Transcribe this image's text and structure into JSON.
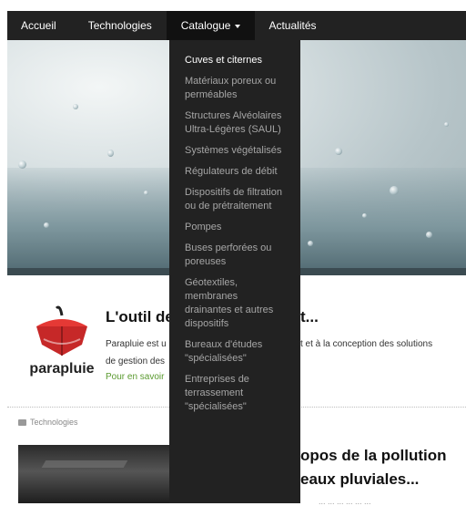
{
  "nav": {
    "items": [
      {
        "label": "Accueil"
      },
      {
        "label": "Technologies"
      },
      {
        "label": "Catalogue"
      },
      {
        "label": "Actualités"
      }
    ]
  },
  "dropdown": {
    "items": [
      "Cuves et citernes",
      "Matériaux poreux ou perméables",
      "Structures Alvéolaires Ultra-Légères (SAUL)",
      "Systèmes végétalisés",
      "Régulateurs de débit",
      "Dispositifs de filtration ou de prétraitement",
      "Pompes",
      "Buses perforées ou poreuses",
      "Géotextiles, membranes drainantes et autres dispositifs",
      "Bureaux d'études \"spécialisées\"",
      "Entreprises de terrassement \"spécialisées\""
    ]
  },
  "article1": {
    "logo_text": "parapluie",
    "title_left": "L'outil de",
    "title_right": "t...",
    "text1_left": "Parapluie est u",
    "text1_right": "t et à la conception des solutions",
    "text2_left": "de gestion des",
    "link_left": "Pour en savoir"
  },
  "category": {
    "label": "Technologies"
  },
  "article2": {
    "line1": "opos de la pollution",
    "line2": "eaux pluviales...",
    "text": "... ... ... ... ... ..."
  },
  "colors": {
    "nav_bg": "#222222",
    "link": "#5a9a2f"
  }
}
